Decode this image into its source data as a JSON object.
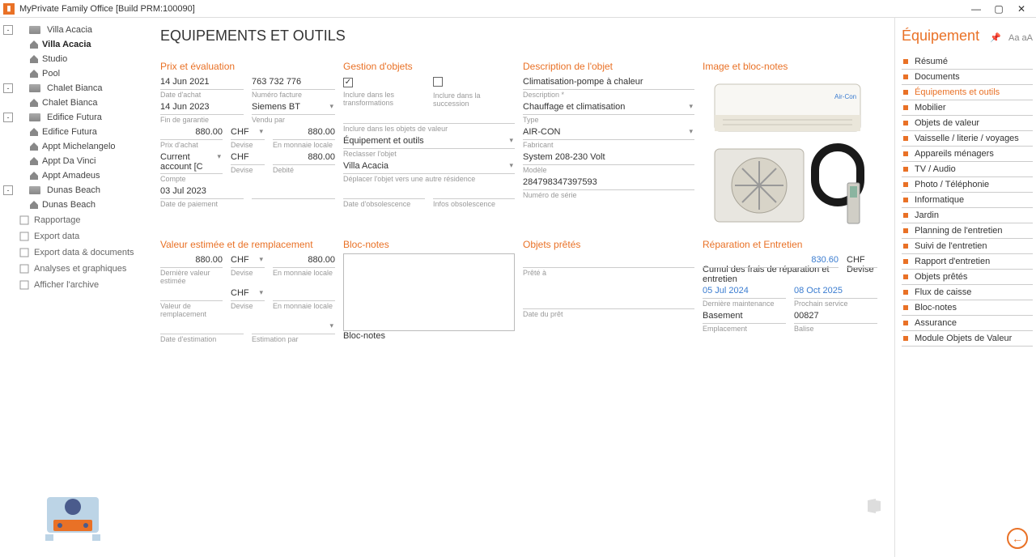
{
  "app": {
    "title": "MyPrivate Family Office [Build PRM:100090]"
  },
  "window_controls": {
    "min": "—",
    "max": "▢",
    "close": "✕"
  },
  "tree": {
    "nodes": [
      {
        "label": "Villa Acacia",
        "type": "folder",
        "toggle": "-",
        "depth": 0
      },
      {
        "label": "Villa Acacia",
        "type": "home",
        "depth": 1,
        "selected": true
      },
      {
        "label": "Studio",
        "type": "home",
        "depth": 1
      },
      {
        "label": "Pool",
        "type": "home",
        "depth": 1
      },
      {
        "label": "Chalet Bianca",
        "type": "folder",
        "toggle": "-",
        "depth": 0
      },
      {
        "label": "Chalet Bianca",
        "type": "home",
        "depth": 1
      },
      {
        "label": "Edifice Futura",
        "type": "folder",
        "toggle": "-",
        "depth": 0
      },
      {
        "label": "Edifice Futura",
        "type": "home",
        "depth": 1
      },
      {
        "label": "Appt Michelangelo",
        "type": "home",
        "depth": 1
      },
      {
        "label": "Appt Da Vinci",
        "type": "home",
        "depth": 1
      },
      {
        "label": "Appt Amadeus",
        "type": "home",
        "depth": 1
      },
      {
        "label": "Dunas Beach",
        "type": "folder",
        "toggle": "-",
        "depth": 0
      },
      {
        "label": "Dunas Beach",
        "type": "home",
        "depth": 1
      }
    ],
    "actions": [
      {
        "label": "Rapportage",
        "icon": "doc"
      },
      {
        "label": "Export data",
        "icon": "export"
      },
      {
        "label": "Export data & documents",
        "icon": "export"
      },
      {
        "label": "Analyses et graphiques",
        "icon": "chart"
      },
      {
        "label": "Afficher l'archive",
        "icon": "archive"
      }
    ]
  },
  "page": {
    "title": "EQUIPEMENTS ET OUTILS"
  },
  "sections": {
    "prix": "Prix et évaluation",
    "gestion": "Gestion d'objets",
    "desc": "Description de l'objet",
    "image": "Image et bloc-notes",
    "valeur": "Valeur estimée et de remplacement",
    "notes": "Bloc-notes",
    "pret": "Objets prêtés",
    "rep": "Réparation et Entretien"
  },
  "labels": {
    "date_achat": "Date d'achat",
    "num_facture": "Numéro facture",
    "fin_garantie": "Fin de garantie",
    "vendu_par": "Vendu par",
    "prix_achat": "Prix d'achat",
    "devise": "Devise",
    "monnaie_locale": "En monnaie locale",
    "compte": "Compte",
    "debite": "Debité",
    "date_paiement": "Date de paiement",
    "date_obso": "Date d'obsolescence",
    "infos_obso": "Infos obsolescence",
    "inc_transf": "Inclure dans les transformations",
    "inc_succ": "Inclure dans la succession",
    "inc_objval": "Inclure dans les objets de valeur",
    "reclasser": "Reclasser l'objet",
    "deplacer": "Déplacer l'objet vers une autre résidence",
    "desc_lbl": "Description *",
    "type_lbl": "Type",
    "fabricant": "Fabricant",
    "modele": "Modèle",
    "numserie": "Numéro de série",
    "valeur_est": "Dernière valeur estimée",
    "valeur_rempl": "Valeur de remplacement",
    "date_est": "Date d'estimation",
    "est_par": "Estimation par",
    "blocnotes": "Bloc-notes",
    "prete_a": "Prêté à",
    "date_pret": "Date du prêt",
    "cumul": "Cumul des frais de réparation et entretien",
    "dern_maint": "Dernière maintenance",
    "proch_serv": "Prochain service",
    "emplacement": "Emplacement",
    "balise": "Balise"
  },
  "values": {
    "date_achat": "14 Jun 2021",
    "num_facture": "763 732 776",
    "fin_garantie": "14 Jun 2023",
    "vendu_par": "Siemens BT",
    "prix_achat": "880.00",
    "devise1": "CHF",
    "monnaie_locale1": "880.00",
    "compte": "Current account [C",
    "devise2": "CHF",
    "debite": "880.00",
    "date_paiement": "03 Jul 2023",
    "inc_transf_checked": "☑",
    "inc_succ_checked": "☐",
    "reclasser": "Équipement et outils",
    "deplacer": "Villa Acacia",
    "description": "Climatisation-pompe à chaleur",
    "type": "Chauffage et climatisation",
    "fabricant": "AIR-CON",
    "modele": "System 208-230 Volt",
    "numserie": "284798347397593",
    "valeur_est": "880.00",
    "devise3": "CHF",
    "monnaie_locale2": "880.00",
    "devise4": "CHF",
    "cumul": "830.60",
    "cumul_devise": "CHF",
    "dern_maint": "05 Jul 2024",
    "proch_serv": "08 Oct 2025",
    "emplacement": "Basement",
    "balise": "00827"
  },
  "rightpanel": {
    "title": "Équipement",
    "text_size": "Aa aA",
    "items": [
      "Résumé",
      "Documents",
      "Équipements et outils",
      "Mobilier",
      "Objets de valeur",
      "Vaisselle / literie / voyages",
      "Appareils ménagers",
      "TV / Audio",
      "Photo / Téléphonie",
      "Informatique",
      "Jardin",
      "Planning de l'entretien",
      "Suivi de l'entretien",
      "Rapport d'entretien",
      "Objets prêtés",
      "Flux de caisse",
      "Bloc-notes",
      "Assurance",
      "Module Objets de Valeur"
    ],
    "active_index": 2
  }
}
